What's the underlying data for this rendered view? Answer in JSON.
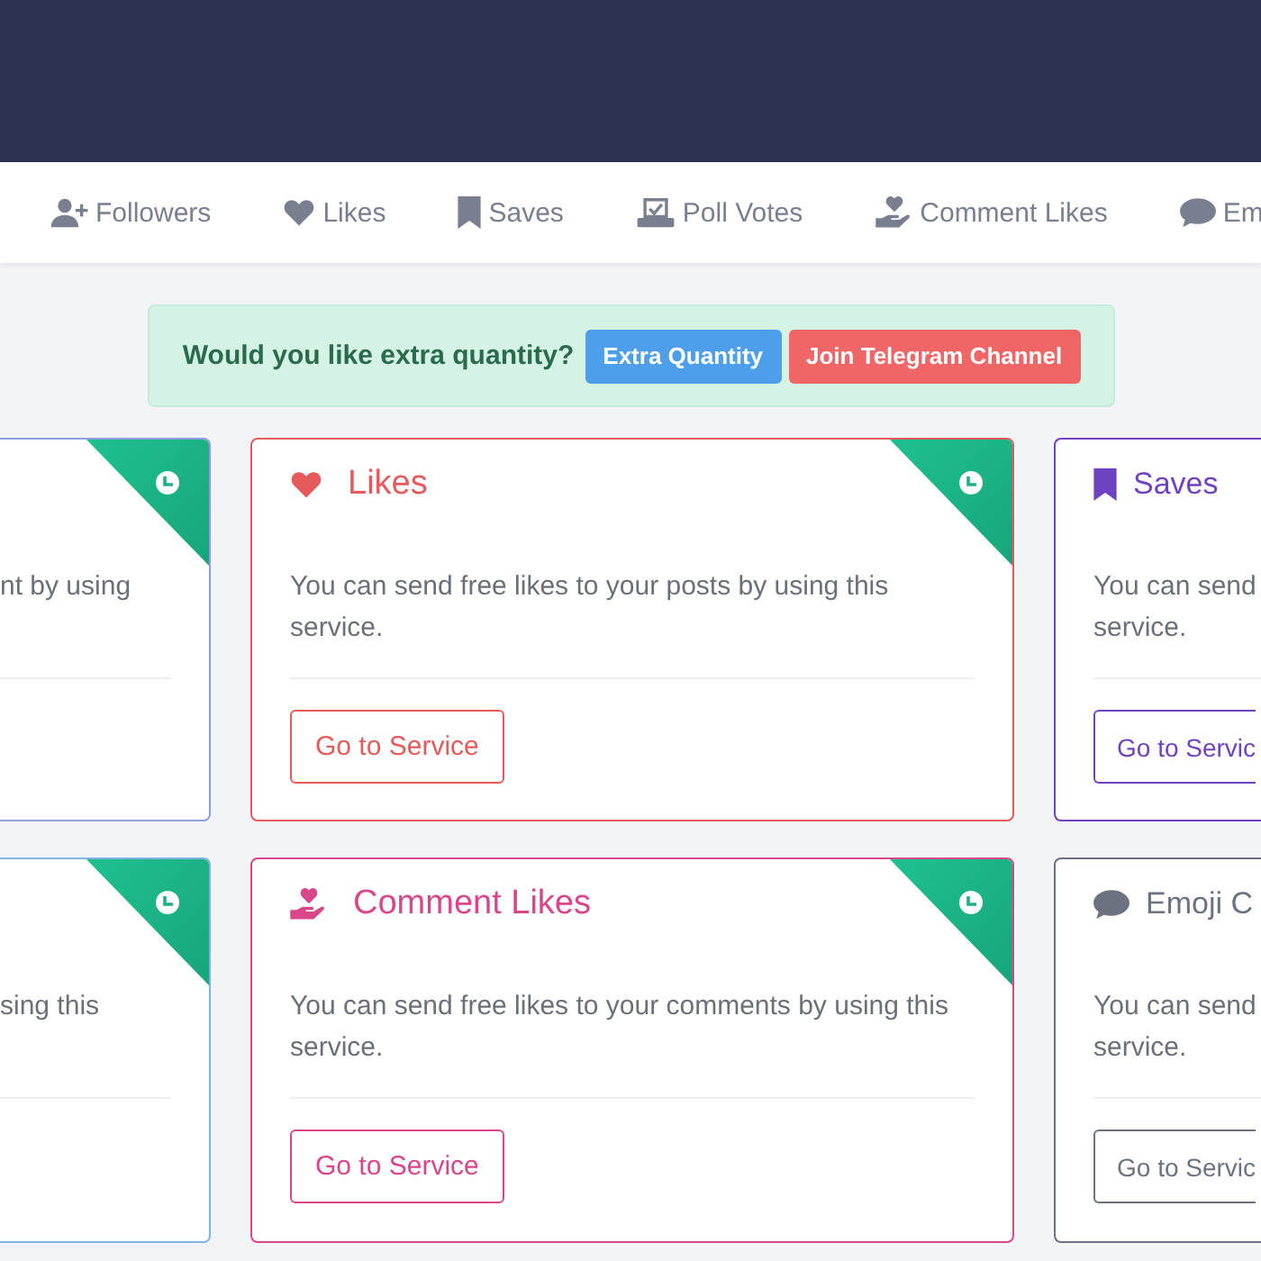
{
  "nav": {
    "items": [
      {
        "label": "Followers",
        "kind": "followers"
      },
      {
        "label": "Likes",
        "kind": "likes"
      },
      {
        "label": "Saves",
        "kind": "saves"
      },
      {
        "label": "Poll Votes",
        "kind": "poll"
      },
      {
        "label": "Comment Likes",
        "kind": "comment-likes"
      },
      {
        "label": "Em",
        "kind": "comment"
      }
    ]
  },
  "alert": {
    "text": "Would you like extra quantity?",
    "buttons": [
      {
        "label": "Extra Quantity",
        "kind": "primary"
      },
      {
        "label": "Join Telegram Channel",
        "kind": "danger"
      }
    ]
  },
  "cards": [
    {
      "color": "#8f9ee0",
      "ribbon": true,
      "description": [
        "nt by using"
      ]
    },
    {
      "kind": "likes",
      "color": "#e55b5b",
      "ribbon": true,
      "title": "Likes",
      "description": [
        "You can send free likes to your posts by using this",
        "service."
      ],
      "button": "Go to Service"
    },
    {
      "kind": "saves",
      "color": "#6f42c1",
      "ribbon": false,
      "title": "Saves",
      "description": [
        "You can send",
        "service."
      ],
      "button": "Go to Servic"
    },
    {
      "color": "#7fb4e6",
      "ribbon": true,
      "description": [
        "sing this"
      ]
    },
    {
      "kind": "comment-likes",
      "color": "#d9468a",
      "ribbon": true,
      "title": "Comment Likes",
      "description": [
        "You can send free likes to your comments by using this",
        "service."
      ],
      "button": "Go to Service"
    },
    {
      "kind": "comment",
      "color": "#6c7280",
      "ribbon": false,
      "title": "Emoji C",
      "description": [
        "You can send",
        "service."
      ],
      "button": "Go to Servic"
    }
  ]
}
